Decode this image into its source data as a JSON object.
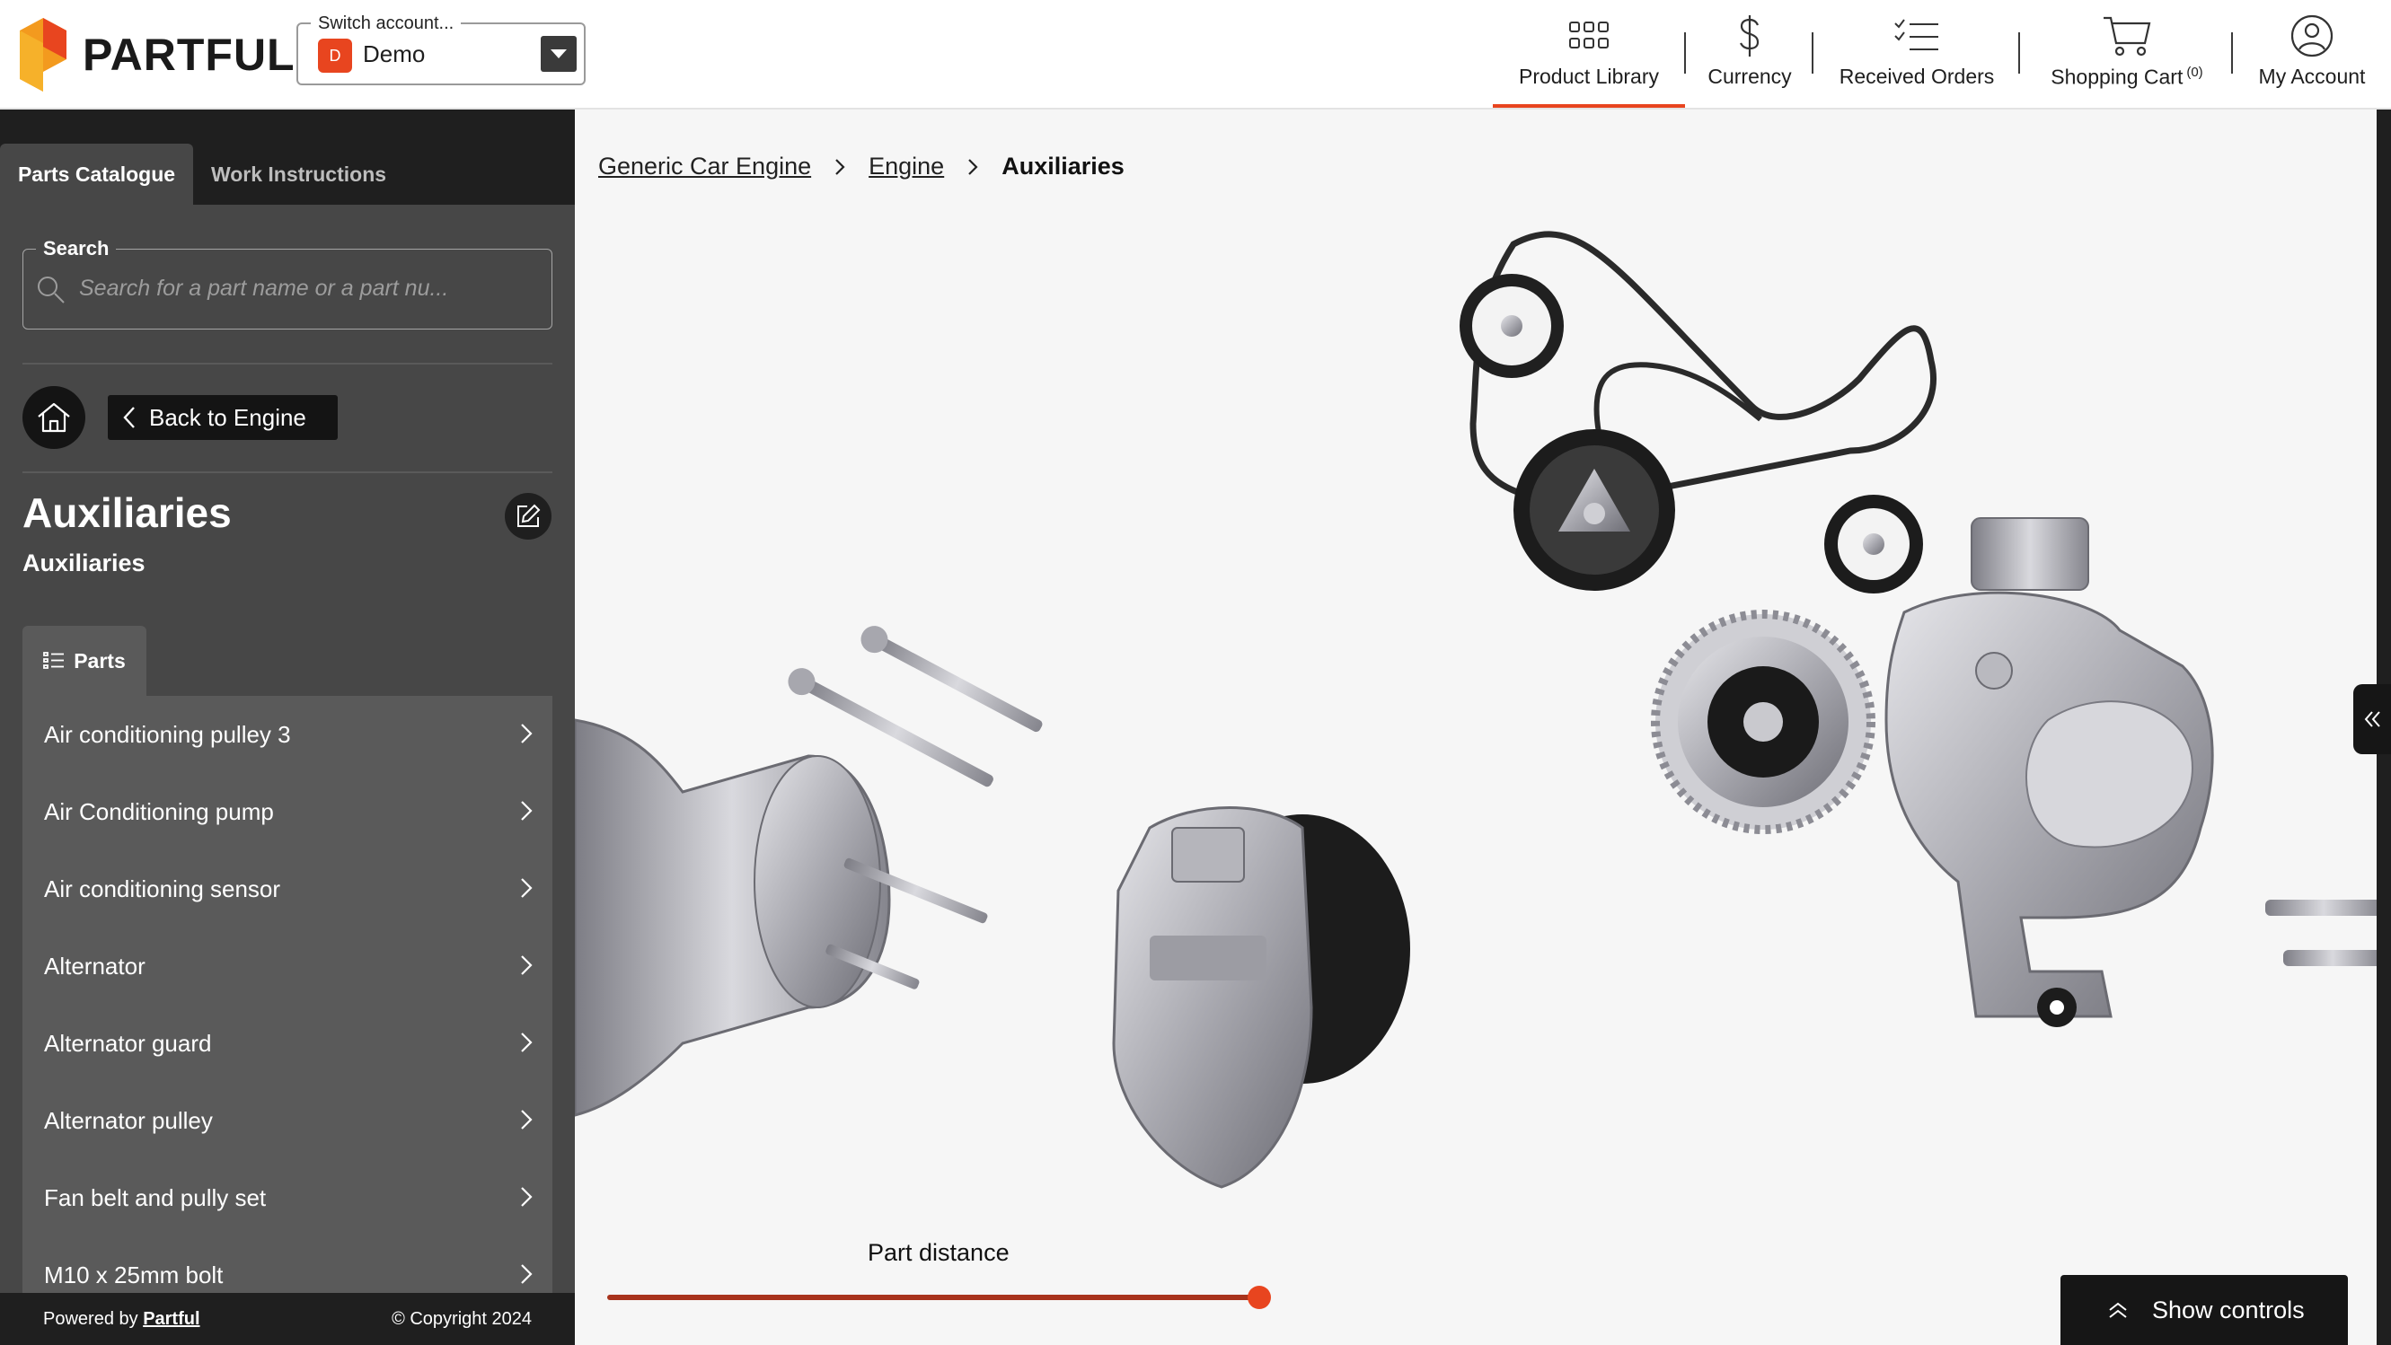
{
  "header": {
    "brand": "PARTFUL",
    "account": {
      "legend": "Switch account...",
      "badge": "D",
      "name": "Demo"
    },
    "nav": [
      {
        "label": "Product Library",
        "icon": "grid-icon",
        "active": true
      },
      {
        "label": "Currency",
        "icon": "dollar-icon",
        "active": false
      },
      {
        "label": "Received Orders",
        "icon": "checklist-icon",
        "active": false
      },
      {
        "label": "Shopping Cart",
        "icon": "cart-icon",
        "active": false,
        "count": "(0)"
      },
      {
        "label": "My Account",
        "icon": "user-icon",
        "active": false
      }
    ]
  },
  "sidebar": {
    "tabs": [
      "Parts Catalogue",
      "Work Instructions"
    ],
    "search": {
      "legend": "Search",
      "placeholder": "Search for a part name or a part nu..."
    },
    "back_label": "Back to Engine",
    "title": "Auxiliaries",
    "subtitle": "Auxiliaries",
    "parts_tab": "Parts",
    "parts": [
      "Air conditioning pulley 3",
      "Air Conditioning pump",
      "Air conditioning sensor",
      "Alternator",
      "Alternator guard",
      "Alternator pulley",
      "Fan belt and pully set",
      "M10 x 25mm bolt"
    ],
    "footer": {
      "powered_prefix": "Powered by",
      "powered_link": "Partful",
      "copyright": "© Copyright 2024"
    }
  },
  "viewer": {
    "breadcrumb": [
      "Generic Car Engine",
      "Engine",
      "Auxiliaries"
    ],
    "slider_label": "Part distance",
    "slider_value": 1.0,
    "show_controls": "Show controls"
  },
  "colors": {
    "accent": "#e8451f",
    "sidebar_bg": "#474747",
    "dark": "#1f1f1f"
  }
}
